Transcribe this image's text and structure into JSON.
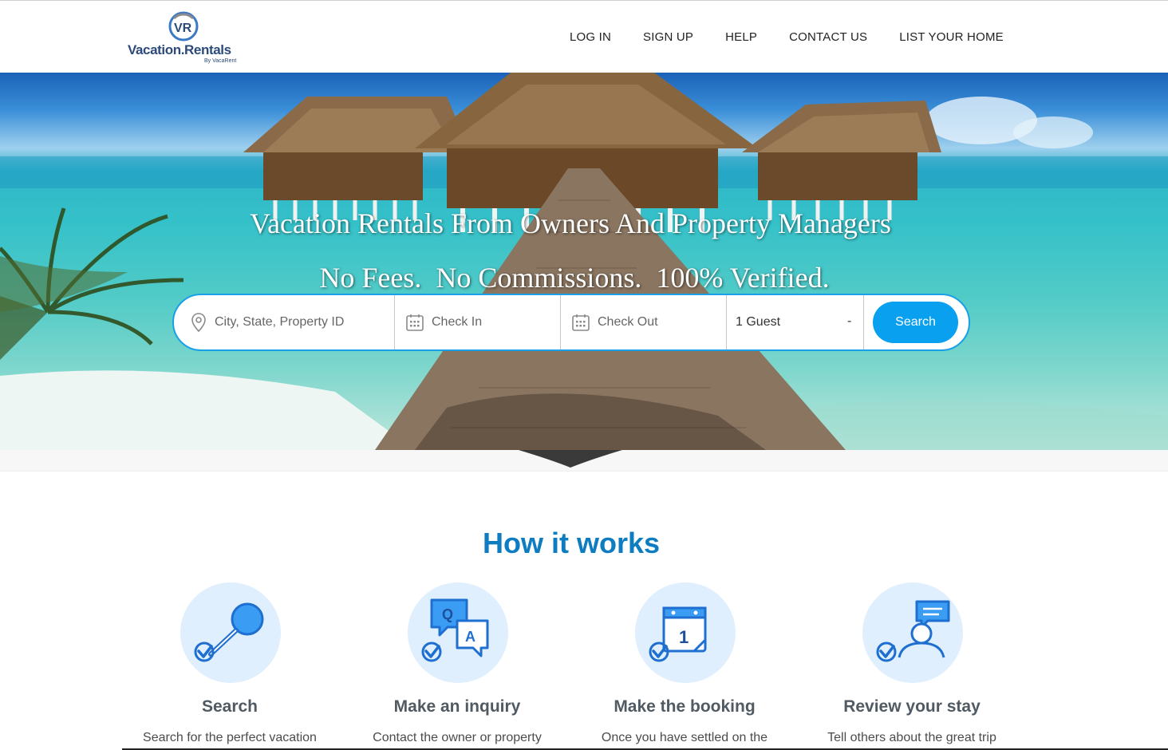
{
  "brand": {
    "name": "Vacation.Rentals",
    "tagline": "By VacaRent",
    "monogram": "VR"
  },
  "nav": {
    "items": [
      {
        "label": "LOG IN"
      },
      {
        "label": "SIGN UP"
      },
      {
        "label": "HELP"
      },
      {
        "label": "CONTACT US"
      },
      {
        "label": "LIST YOUR HOME"
      }
    ]
  },
  "hero": {
    "title": "Vacation Rentals From Owners And Property Managers",
    "subtitle": "No Fees.  No Commissions.  100% Verified."
  },
  "search": {
    "location_placeholder": "City, State,  Property ID",
    "checkin_placeholder": "Check In",
    "checkout_placeholder": "Check Out",
    "guests_value": "1 Guest",
    "guests_dash": "-",
    "button_label": "Search",
    "icons": {
      "location": "map-pin-icon",
      "calendar": "calendar-icon"
    }
  },
  "how_it_works": {
    "title": "How it works",
    "steps": [
      {
        "title": "Search",
        "description": "Search for the perfect vacation",
        "icon": "magnifier-check-icon"
      },
      {
        "title": "Make an inquiry",
        "description": "Contact the owner or property",
        "icon": "qa-bubbles-icon"
      },
      {
        "title": "Make the booking",
        "description": "Once you have settled on the",
        "icon": "calendar-check-icon"
      },
      {
        "title": "Review your stay",
        "description": "Tell others about the great trip",
        "icon": "user-review-icon"
      }
    ]
  },
  "colors": {
    "accent": "#0aa0f0",
    "heading": "#0d7cc1",
    "icon_blue": "#1e88e5",
    "icon_bg": "#dfeffd",
    "brand_navy": "#2c4a7a"
  }
}
